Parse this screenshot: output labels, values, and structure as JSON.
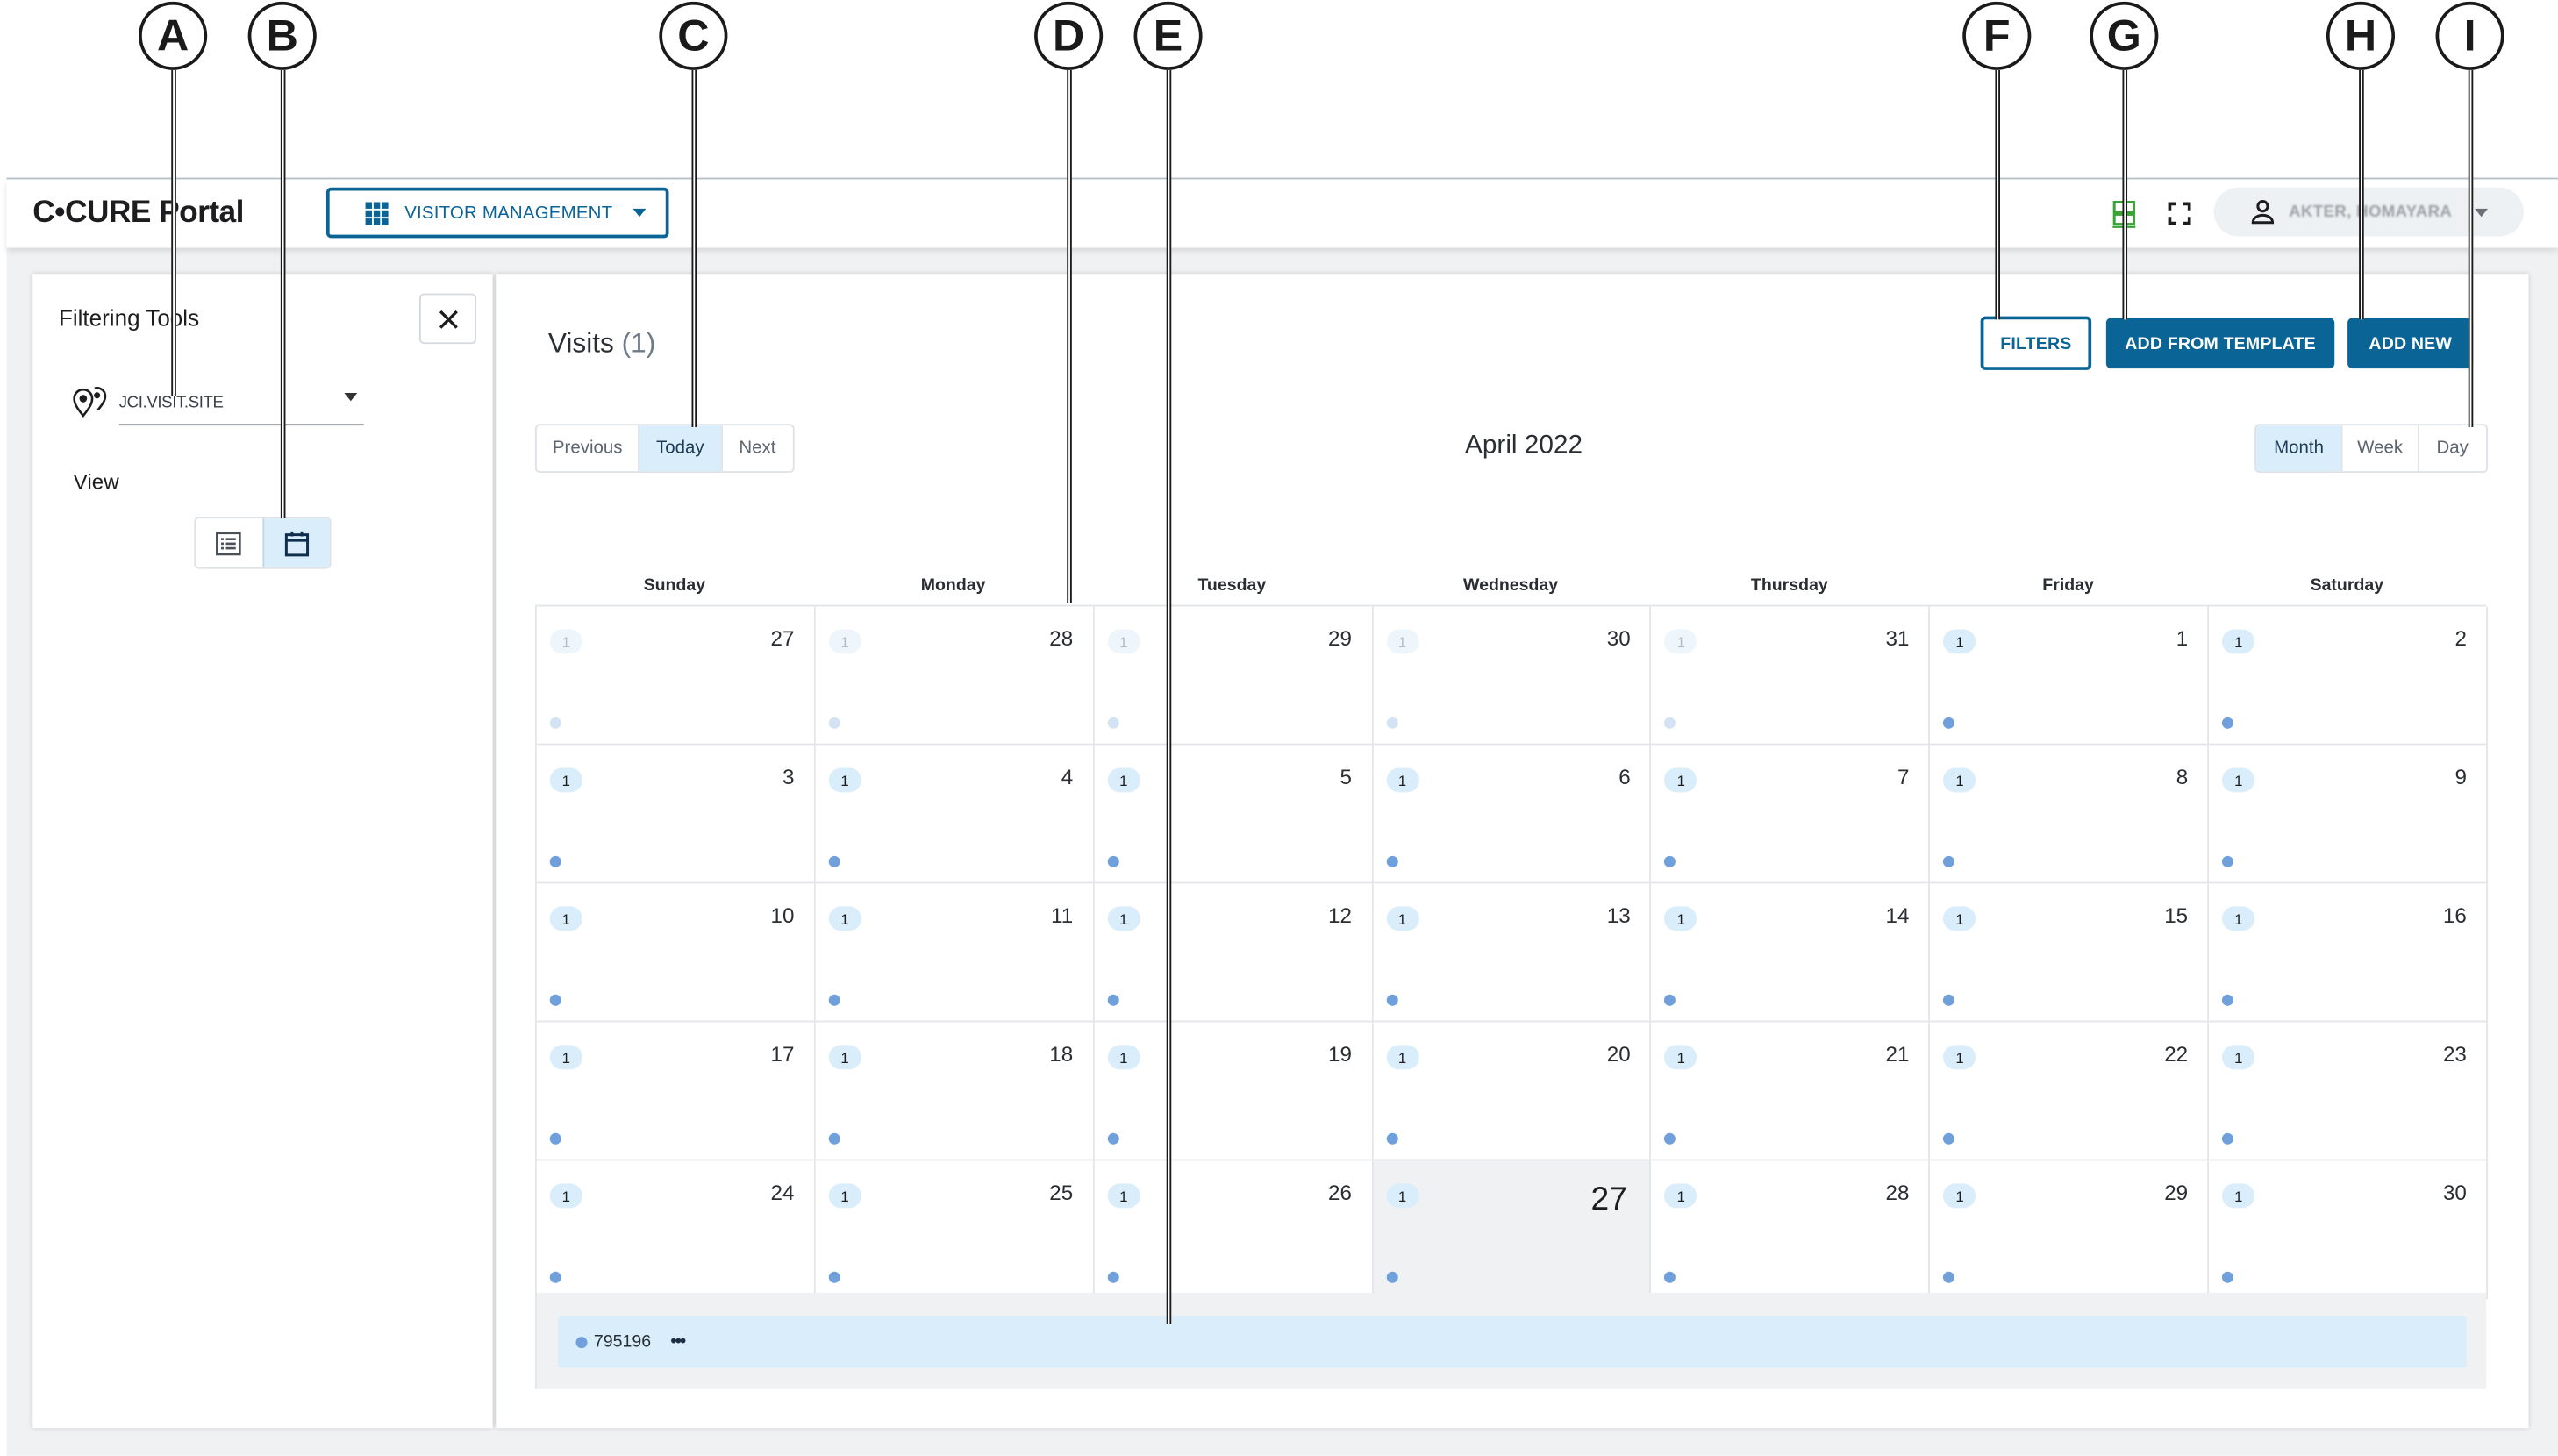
{
  "callouts": [
    "A",
    "B",
    "C",
    "D",
    "E",
    "F",
    "G",
    "H",
    "I"
  ],
  "header": {
    "brand": "C•CURE Portal",
    "module_label": "VISITOR MANAGEMENT",
    "user_name": "AKTER, HOMAYARA"
  },
  "filter_panel": {
    "title": "Filtering Tools",
    "site_value": "JCI.VISIT.SITE",
    "view_label": "View",
    "view_options": [
      "list",
      "calendar"
    ],
    "active_view": "calendar"
  },
  "main": {
    "title": "Visits",
    "count": "(1)",
    "buttons": {
      "filters": "FILTERS",
      "add_from_template": "ADD FROM TEMPLATE",
      "add_new": "ADD NEW"
    },
    "nav": [
      "Previous",
      "Today",
      "Next"
    ],
    "nav_active": "Today",
    "month_title": "April 2022",
    "range": [
      "Month",
      "Week",
      "Day"
    ],
    "range_active": "Month"
  },
  "calendar": {
    "weekdays": [
      "Sunday",
      "Monday",
      "Tuesday",
      "Wednesday",
      "Thursday",
      "Friday",
      "Saturday"
    ],
    "weeks": [
      [
        {
          "d": "27",
          "c": "1",
          "o": true
        },
        {
          "d": "28",
          "c": "1",
          "o": true
        },
        {
          "d": "29",
          "c": "1",
          "o": true
        },
        {
          "d": "30",
          "c": "1",
          "o": true
        },
        {
          "d": "31",
          "c": "1",
          "o": true
        },
        {
          "d": "1",
          "c": "1"
        },
        {
          "d": "2",
          "c": "1"
        }
      ],
      [
        {
          "d": "3",
          "c": "1"
        },
        {
          "d": "4",
          "c": "1"
        },
        {
          "d": "5",
          "c": "1"
        },
        {
          "d": "6",
          "c": "1"
        },
        {
          "d": "7",
          "c": "1"
        },
        {
          "d": "8",
          "c": "1"
        },
        {
          "d": "9",
          "c": "1"
        }
      ],
      [
        {
          "d": "10",
          "c": "1"
        },
        {
          "d": "11",
          "c": "1"
        },
        {
          "d": "12",
          "c": "1"
        },
        {
          "d": "13",
          "c": "1"
        },
        {
          "d": "14",
          "c": "1"
        },
        {
          "d": "15",
          "c": "1"
        },
        {
          "d": "16",
          "c": "1"
        }
      ],
      [
        {
          "d": "17",
          "c": "1"
        },
        {
          "d": "18",
          "c": "1"
        },
        {
          "d": "19",
          "c": "1"
        },
        {
          "d": "20",
          "c": "1"
        },
        {
          "d": "21",
          "c": "1"
        },
        {
          "d": "22",
          "c": "1"
        },
        {
          "d": "23",
          "c": "1"
        }
      ],
      [
        {
          "d": "24",
          "c": "1"
        },
        {
          "d": "25",
          "c": "1"
        },
        {
          "d": "26",
          "c": "1"
        },
        {
          "d": "27",
          "c": "1",
          "today": true
        },
        {
          "d": "28",
          "c": "1"
        },
        {
          "d": "29",
          "c": "1"
        },
        {
          "d": "30",
          "c": "1"
        }
      ]
    ],
    "selected_event": {
      "id": "795196",
      "more": "•••"
    }
  },
  "colors": {
    "accent": "#0b6496",
    "selected_bg": "#d9eefa",
    "event_dot": "#6fa0dc",
    "today_bg": "#f0f1f3"
  }
}
